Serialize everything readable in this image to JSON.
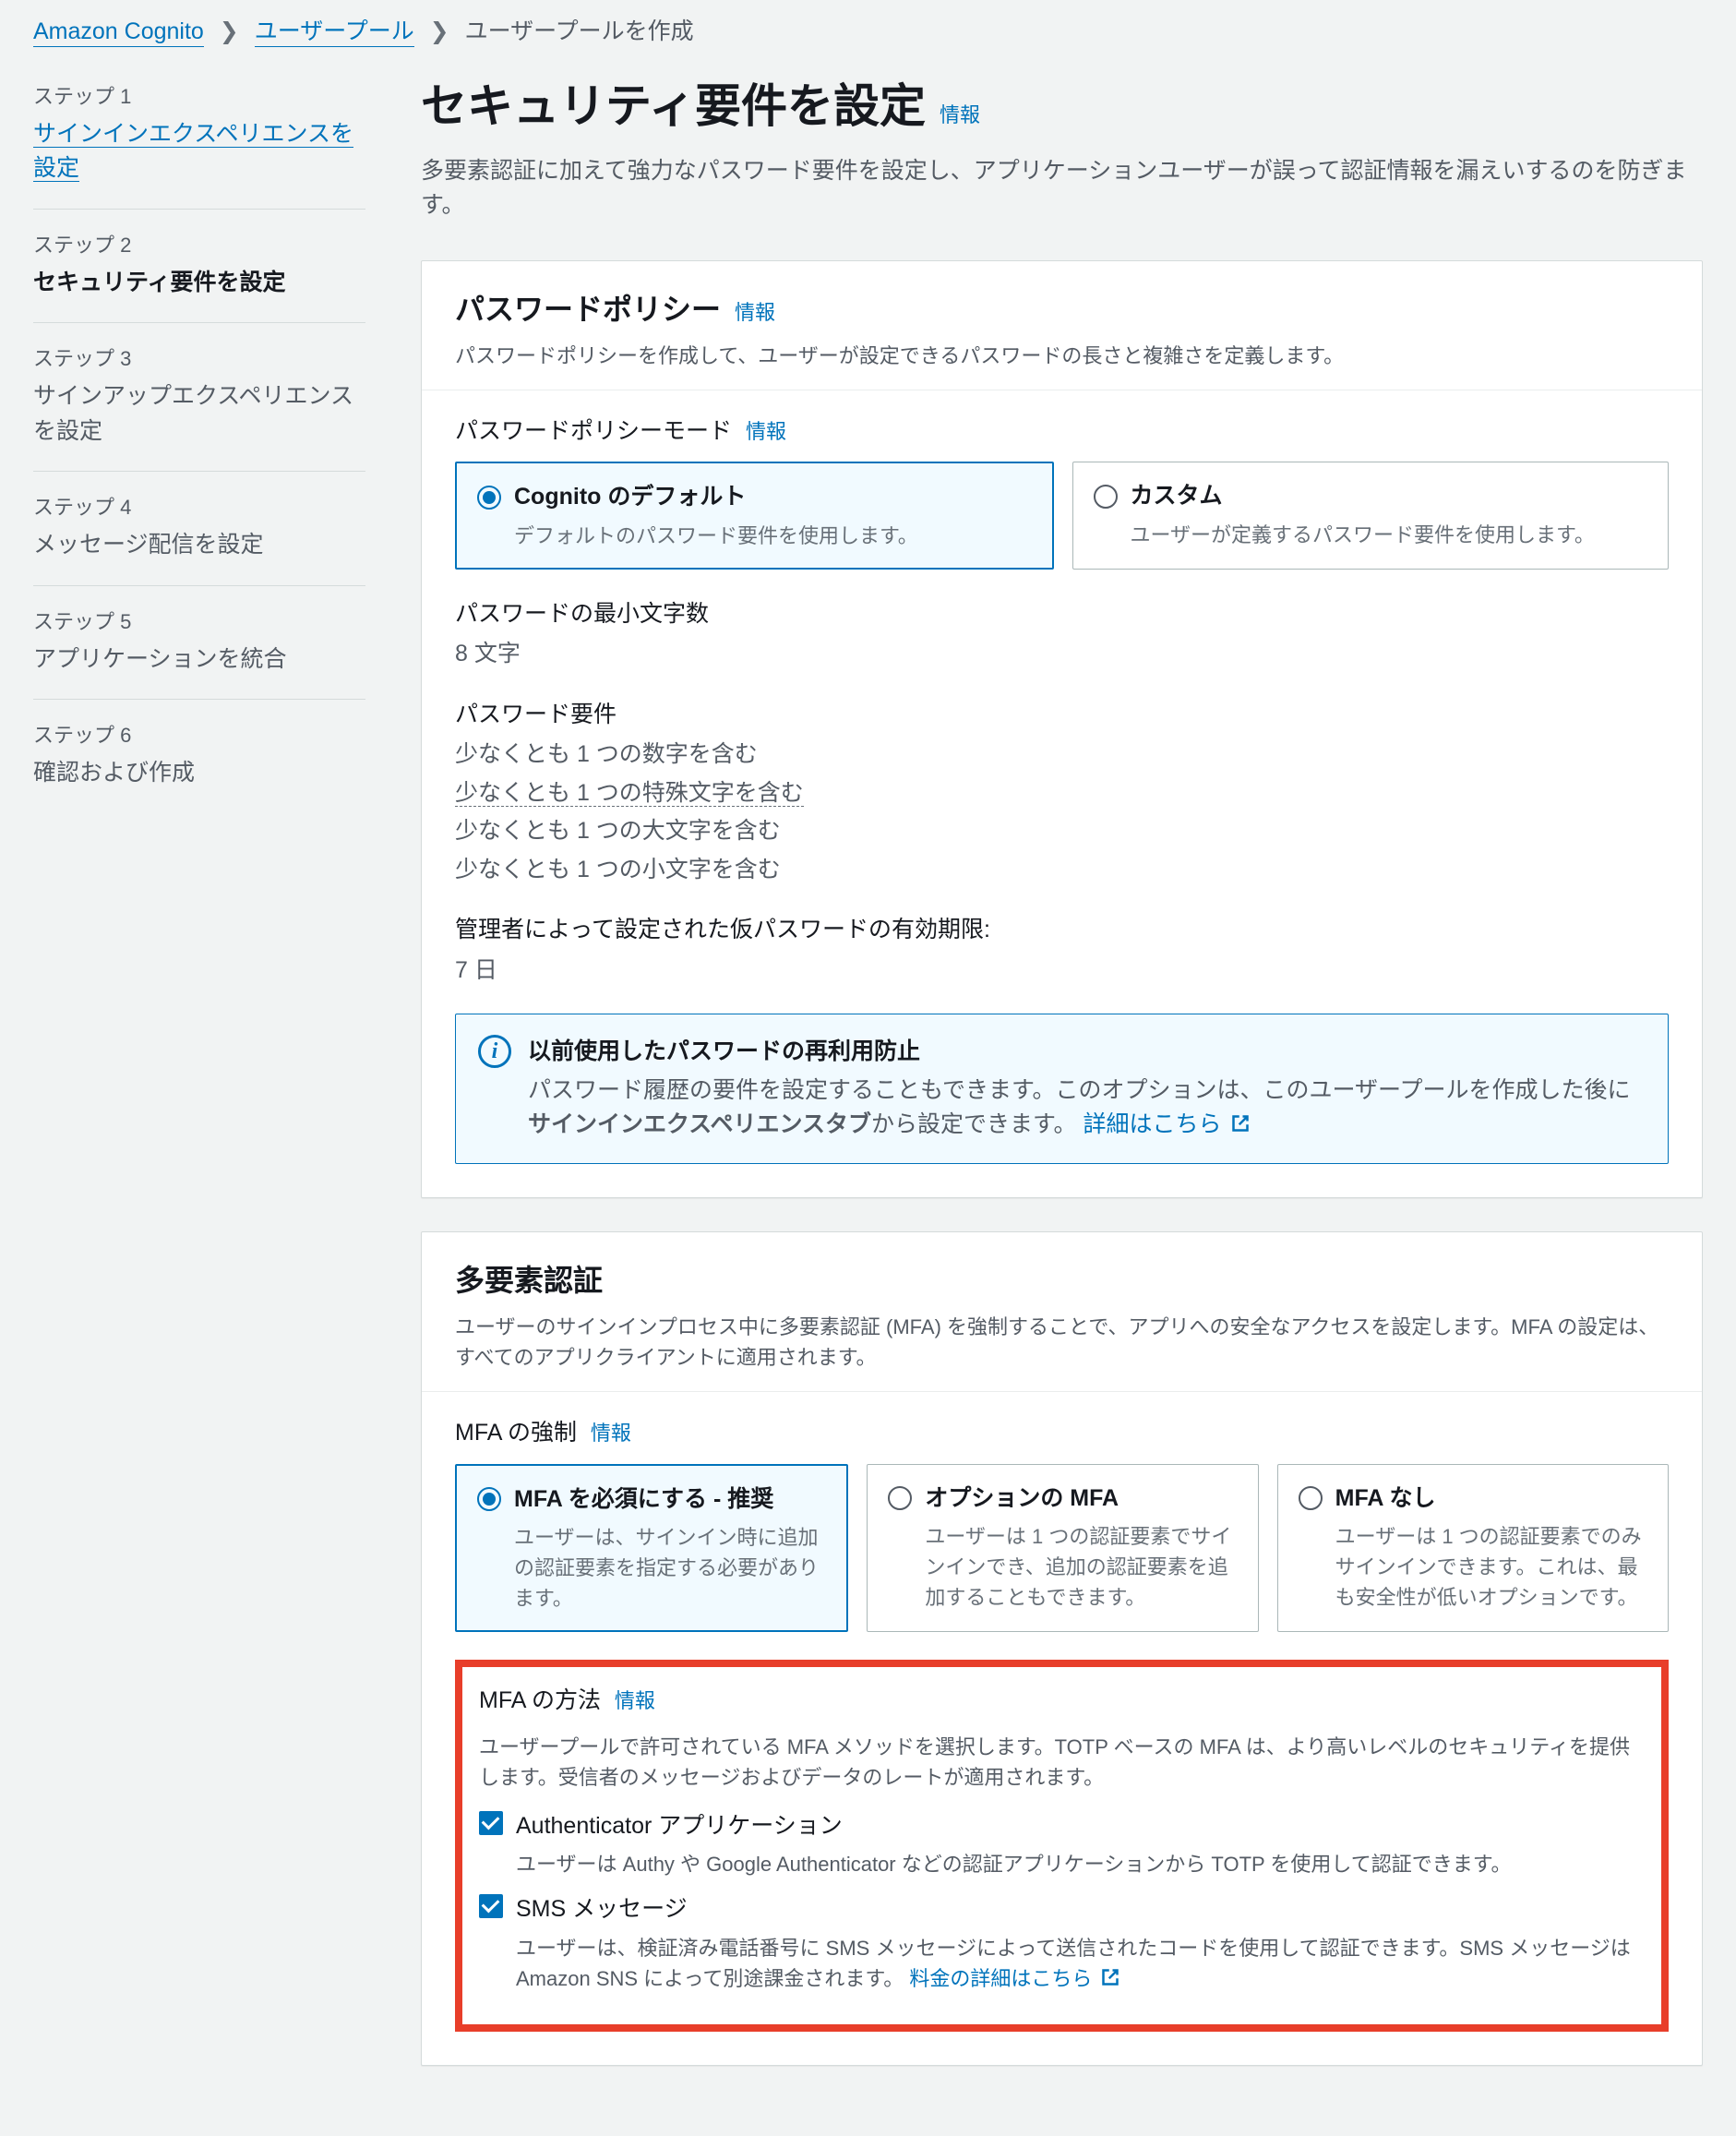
{
  "breadcrumb": {
    "cognito": "Amazon Cognito",
    "userpool": "ユーザープール",
    "create": "ユーザープールを作成"
  },
  "sidebar": {
    "steps": [
      {
        "num": "ステップ 1",
        "title": "サインインエクスペリエンスを設定",
        "link": true
      },
      {
        "num": "ステップ 2",
        "title": "セキュリティ要件を設定",
        "active": true
      },
      {
        "num": "ステップ 3",
        "title": "サインアップエクスペリエンスを設定"
      },
      {
        "num": "ステップ 4",
        "title": "メッセージ配信を設定"
      },
      {
        "num": "ステップ 5",
        "title": "アプリケーションを統合"
      },
      {
        "num": "ステップ 6",
        "title": "確認および作成"
      }
    ]
  },
  "header": {
    "title": "セキュリティ要件を設定",
    "info": "情報",
    "desc": "多要素認証に加えて強力なパスワード要件を設定し、アプリケーションユーザーが誤って認証情報を漏えいするのを防ぎます。"
  },
  "password_policy": {
    "title": "パスワードポリシー",
    "info": "情報",
    "desc": "パスワードポリシーを作成して、ユーザーが設定できるパスワードの長さと複雑さを定義します。",
    "mode_label": "パスワードポリシーモード",
    "mode_info": "情報",
    "options": [
      {
        "title": "Cognito のデフォルト",
        "desc": "デフォルトのパスワード要件を使用します。",
        "selected": true
      },
      {
        "title": "カスタム",
        "desc": "ユーザーが定義するパスワード要件を使用します。",
        "selected": false
      }
    ],
    "min_len_label": "パスワードの最小文字数",
    "min_len_value": "8 文字",
    "req_label": "パスワード要件",
    "requirements": [
      "少なくとも 1 つの数字を含む",
      "少なくとも 1 つの特殊文字を含む",
      "少なくとも 1 つの大文字を含む",
      "少なくとも 1 つの小文字を含む"
    ],
    "temp_label": "管理者によって設定された仮パスワードの有効期限:",
    "temp_value": "7 日",
    "infobox": {
      "title": "以前使用したパスワードの再利用防止",
      "text1": "パスワード履歴の要件を設定することもできます。このオプションは、このユーザープールを作成した後に",
      "bold": "サインインエクスペリエンスタブ",
      "text2": "から設定できます。",
      "link": "詳細はこちら"
    }
  },
  "mfa": {
    "title": "多要素認証",
    "desc": "ユーザーのサインインプロセス中に多要素認証 (MFA) を強制することで、アプリへの安全なアクセスを設定します。MFA の設定は、すべてのアプリクライアントに適用されます。",
    "enforce_label": "MFA の強制",
    "info": "情報",
    "options": [
      {
        "title": "MFA を必須にする - 推奨",
        "desc": "ユーザーは、サインイン時に追加の認証要素を指定する必要があります。",
        "selected": true
      },
      {
        "title": "オプションの MFA",
        "desc": "ユーザーは 1 つの認証要素でサインインでき、追加の認証要素を追加することもできます。",
        "selected": false
      },
      {
        "title": "MFA なし",
        "desc": "ユーザーは 1 つの認証要素でのみサインインできます。これは、最も安全性が低いオプションです。",
        "selected": false
      }
    ],
    "methods_label": "MFA の方法",
    "methods_info": "情報",
    "methods_desc": "ユーザープールで許可されている MFA メソッドを選択します。TOTP ベースの MFA は、より高いレベルのセキュリティを提供します。受信者のメッセージおよびデータのレートが適用されます。",
    "authenticator_label": "Authenticator アプリケーション",
    "authenticator_desc": "ユーザーは Authy や Google Authenticator などの認証アプリケーションから TOTP を使用して認証できます。",
    "sms_label": "SMS メッセージ",
    "sms_desc_1": "ユーザーは、検証済み電話番号に SMS メッセージによって送信されたコードを使用して認証できます。SMS メッセージは Amazon SNS によって別途課金されます。",
    "sms_link": "料金の詳細はこちら"
  }
}
